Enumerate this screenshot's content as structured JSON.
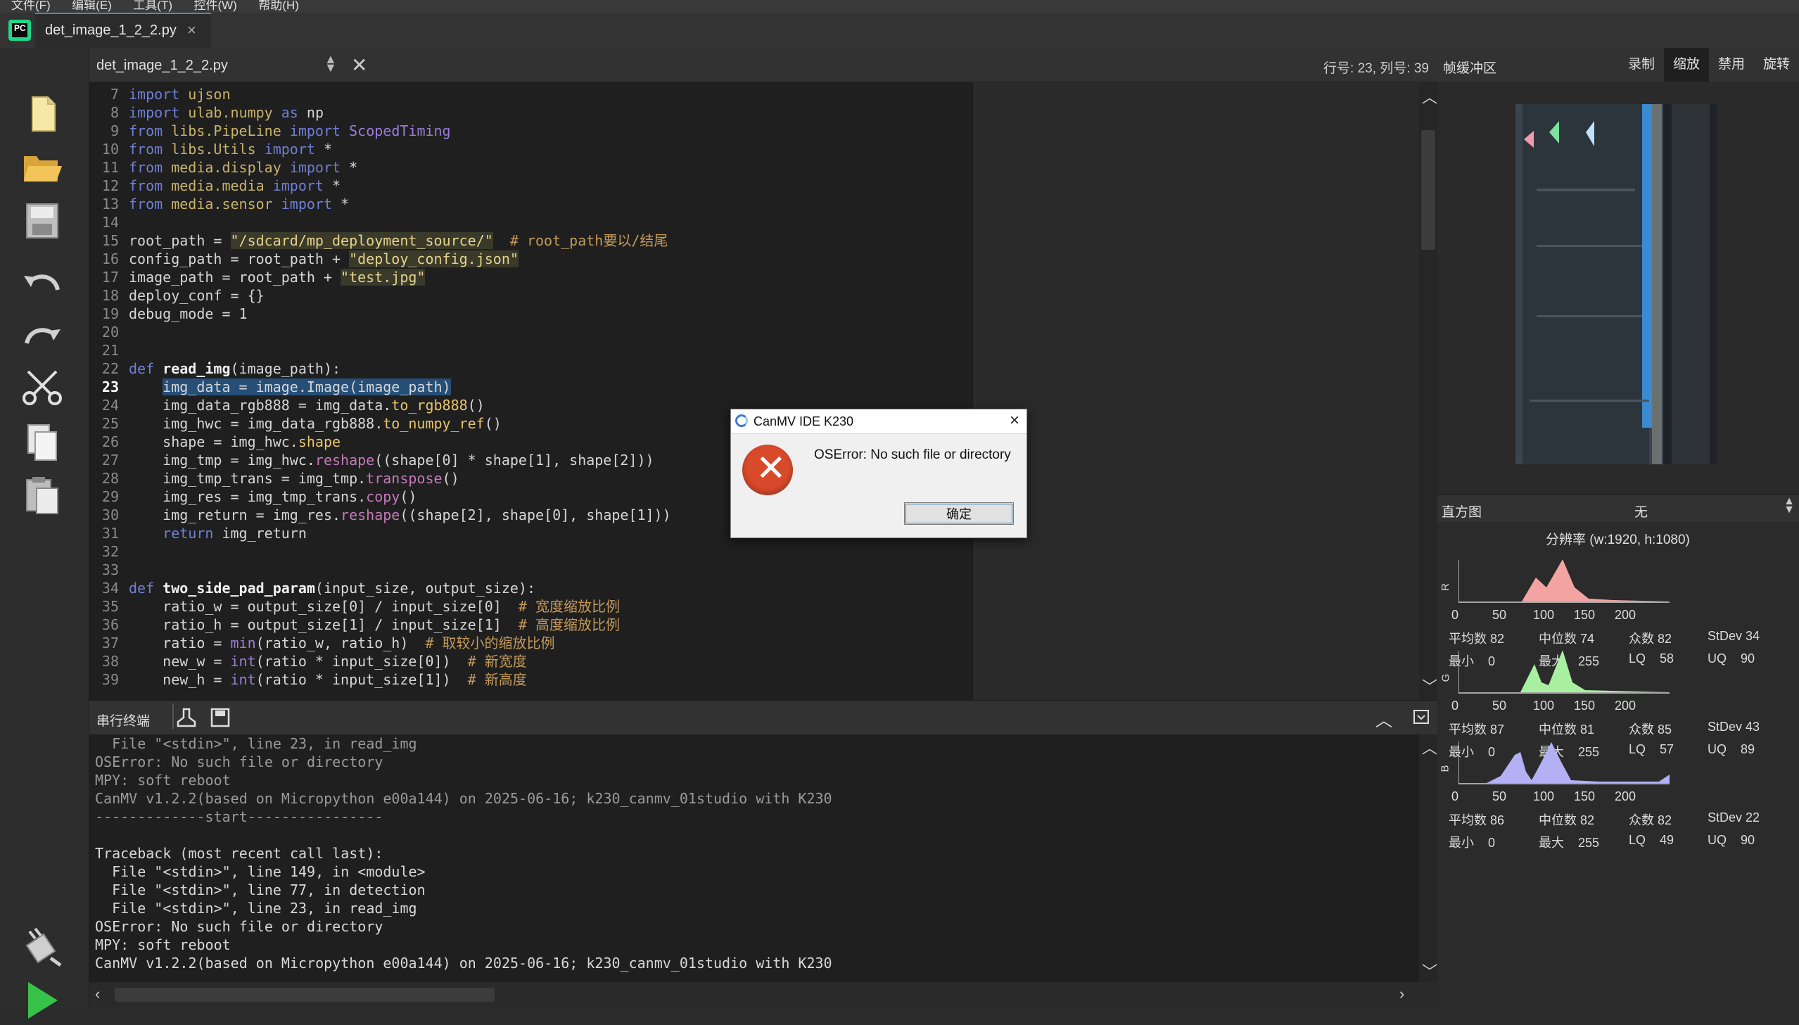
{
  "menu": [
    "文件(F)",
    "编辑(E)",
    "工具(T)",
    "控件(W)",
    "帮助(H)"
  ],
  "tab": {
    "title": "det_image_1_2_2.py",
    "close": "×"
  },
  "editor": {
    "filename": "det_image_1_2_2.py",
    "cursor_pos": "行号: 23, 列号: 39",
    "lines": [
      {
        "n": "7",
        "html": "<span class='kw'>import</span> <span class='mod'>ujson</span>"
      },
      {
        "n": "8",
        "html": "<span class='kw'>import</span> <span class='mod'>ulab.numpy</span> <span class='kw'>as</span> np"
      },
      {
        "n": "9",
        "html": "<span class='kw'>from</span> <span class='mod'>libs.PipeLine</span> <span class='kw'>import</span> <span class='bi'>ScopedTiming</span>"
      },
      {
        "n": "10",
        "html": "<span class='kw'>from</span> <span class='mod'>libs.Utils</span> <span class='kw'>import</span> *"
      },
      {
        "n": "11",
        "html": "<span class='kw'>from</span> <span class='mod'>media.display</span> <span class='kw'>import</span> *"
      },
      {
        "n": "12",
        "html": "<span class='kw'>from</span> <span class='mod'>media.media</span> <span class='kw'>import</span> *"
      },
      {
        "n": "13",
        "html": "<span class='kw'>from</span> <span class='mod'>media.sensor</span> <span class='kw'>import</span> *"
      },
      {
        "n": "14",
        "html": ""
      },
      {
        "n": "15",
        "html": "root_path = <span class='str'>\"/sdcard/mp_deployment_source/\"</span>  <span class='cm'># root_path要以/结尾</span>"
      },
      {
        "n": "16",
        "html": "config_path = root_path + <span class='str'>\"deploy_config.json\"</span>"
      },
      {
        "n": "17",
        "html": "image_path = root_path + <span class='str'>\"test.jpg\"</span>"
      },
      {
        "n": "18",
        "html": "deploy_conf = {}"
      },
      {
        "n": "19",
        "html": "debug_mode = 1"
      },
      {
        "n": "20",
        "html": ""
      },
      {
        "n": "21",
        "html": ""
      },
      {
        "n": "22",
        "html": "<span class='kw'>def</span> <span class='def'>read_img</span>(image_path):"
      },
      {
        "n": "23",
        "html": "    <span class='hl'>img_data = image.Image(image_path)</span>",
        "current": true
      },
      {
        "n": "24",
        "html": "    img_data_rgb888 = img_data.<span class='fn'>to_rgb888</span>()"
      },
      {
        "n": "25",
        "html": "    img_hwc = img_data_rgb888.<span class='fn'>to_numpy_ref</span>()"
      },
      {
        "n": "26",
        "html": "    shape = img_hwc.<span class='fn'>shape</span>"
      },
      {
        "n": "27",
        "html": "    img_tmp = img_hwc.<span class='meth'>reshape</span>((shape[0] * shape[1], shape[2]))"
      },
      {
        "n": "28",
        "html": "    img_tmp_trans = img_tmp.<span class='meth'>transpose</span>()"
      },
      {
        "n": "29",
        "html": "    img_res = img_tmp_trans.<span class='meth'>copy</span>()"
      },
      {
        "n": "30",
        "html": "    img_return = img_res.<span class='meth'>reshape</span>((shape[2], shape[0], shape[1]))"
      },
      {
        "n": "31",
        "html": "    <span class='kw'>return</span> img_return"
      },
      {
        "n": "32",
        "html": ""
      },
      {
        "n": "33",
        "html": ""
      },
      {
        "n": "34",
        "html": "<span class='kw'>def</span> <span class='def'>two_side_pad_param</span>(input_size, output_size):"
      },
      {
        "n": "35",
        "html": "    ratio_w = output_size[0] / input_size[0]  <span class='cm'># 宽度缩放比例</span>"
      },
      {
        "n": "36",
        "html": "    ratio_h = output_size[1] / input_size[1]  <span class='cm'># 高度缩放比例</span>"
      },
      {
        "n": "37",
        "html": "    ratio = <span class='bi'>min</span>(ratio_w, ratio_h)  <span class='cm'># 取较小的缩放比例</span>"
      },
      {
        "n": "38",
        "html": "    new_w = <span class='bi'>int</span>(ratio * input_size[0])  <span class='cm'># 新宽度</span>"
      },
      {
        "n": "39",
        "html": "    new_h = <span class='bi'>int</span>(ratio * input_size[1])  <span class='cm'># 新高度</span>"
      }
    ]
  },
  "terminal": {
    "title": "串行终端",
    "lines": [
      {
        "t": "  File \"<stdin>\", line 23, in read_img",
        "c": "dim"
      },
      {
        "t": "OSError: No such file or directory",
        "c": "dim"
      },
      {
        "t": "MPY: soft reboot",
        "c": "dim"
      },
      {
        "t": "CanMV v1.2.2(based on Micropython e00a144) on 2025-06-16; k230_canmv_01studio with K230",
        "c": "dim"
      },
      {
        "t": "-------------start----------------",
        "c": "dim"
      },
      {
        "t": "",
        "c": "nor"
      },
      {
        "t": "Traceback (most recent call last):",
        "c": "nor"
      },
      {
        "t": "  File \"<stdin>\", line 149, in <module>",
        "c": "nor"
      },
      {
        "t": "  File \"<stdin>\", line 77, in detection",
        "c": "nor"
      },
      {
        "t": "  File \"<stdin>\", line 23, in read_img",
        "c": "nor"
      },
      {
        "t": "OSError: No such file or directory",
        "c": "nor"
      },
      {
        "t": "MPY: soft reboot",
        "c": "nor"
      },
      {
        "t": "CanMV v1.2.2(based on Micropython e00a144) on 2025-06-16; k230_canmv_01studio with K230",
        "c": "nor"
      }
    ]
  },
  "framebuffer": {
    "title": "帧缓冲区",
    "buttons": [
      "录制",
      "缩放",
      "禁用",
      "旋转"
    ],
    "active": "缩放"
  },
  "histogram": {
    "title": "直方图",
    "colorspace": "无",
    "resolution": "分辨率 (w:1920, h:1080)",
    "ticks": [
      "0",
      "50",
      "100",
      "150",
      "200"
    ],
    "channels": [
      {
        "name": "R",
        "color": "#f4a3a3",
        "stats": {
          "mean": "平均数 82",
          "median": "中位数 74",
          "mode": "众数 82",
          "stdev": "StDev 34",
          "min": "最小    0",
          "max": "最大    255",
          "lq": "LQ    58",
          "uq": "UQ    90"
        }
      },
      {
        "name": "G",
        "color": "#a8f0a0",
        "stats": {
          "mean": "平均数 87",
          "median": "中位数 81",
          "mode": "众数 85",
          "stdev": "StDev 43",
          "min": "最小    0",
          "max": "最大    255",
          "lq": "LQ    57",
          "uq": "UQ    89"
        }
      },
      {
        "name": "B",
        "color": "#b4b0f4",
        "stats": {
          "mean": "平均数 86",
          "median": "中位数 82",
          "mode": "众数 82",
          "stdev": "StDev 22",
          "min": "最小    0",
          "max": "最大    255",
          "lq": "LQ    49",
          "uq": "UQ    90"
        }
      }
    ]
  },
  "dialog": {
    "title": "CanMV IDE K230",
    "message": "OSError: No such file or directory",
    "ok": "确定",
    "close": "×"
  }
}
